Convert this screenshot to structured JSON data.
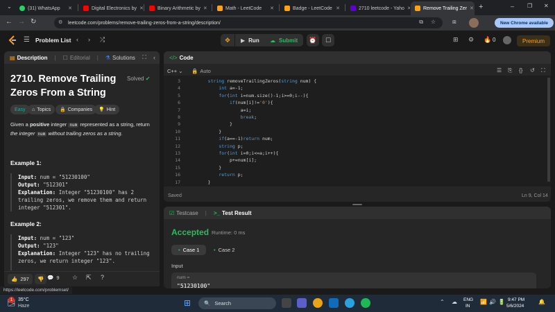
{
  "browser": {
    "tabs": [
      {
        "label": "(31) WhatsApp",
        "color": "#25d366"
      },
      {
        "label": "Digital Electronics by",
        "color": "#ff0000"
      },
      {
        "label": "Binary Arithmetic by",
        "color": "#ff0000"
      },
      {
        "label": "Math - LeetCode",
        "color": "#ffa116"
      },
      {
        "label": "Badge - LeetCode",
        "color": "#ffa116"
      },
      {
        "label": "2710 leetcode - Yaho",
        "color": "#6001d2"
      },
      {
        "label": "Remove Trailing Zer",
        "color": "#ffa116"
      }
    ],
    "url": "leetcode.com/problems/remove-trailing-zeros-from-a-string/description/",
    "new_chrome_label": "New Chrome available",
    "status_url": "https://leetcode.com/problemset/"
  },
  "nav": {
    "problem_list": "Problem List",
    "run": "Run",
    "submit": "Submit",
    "streak": "0",
    "premium": "Premium"
  },
  "left_panel": {
    "tabs": [
      "Description",
      "Editorial",
      "Solutions"
    ],
    "title": "2710. Remove Trailing Zeros From a String",
    "solved": "Solved",
    "chips": [
      "Easy",
      "Topics",
      "Companies",
      "Hint"
    ],
    "desc_parts": [
      "Given a ",
      "positive",
      " integer ",
      "num",
      " represented as a string, return ",
      "the integer ",
      "num",
      " without trailing zeros as a string",
      "."
    ],
    "examples": [
      {
        "title": "Example 1:",
        "input_label": "Input:",
        "input": "num = \"51230100\"",
        "output_label": "Output:",
        "output": "\"512301\"",
        "expl_label": "Explanation:",
        "expl": "Integer \"51230100\" has 2 trailing zeros, we remove them and return integer \"512301\"."
      },
      {
        "title": "Example 2:",
        "input_label": "Input:",
        "input": "num = \"123\"",
        "output_label": "Output:",
        "output": "\"123\"",
        "expl_label": "Explanation:",
        "expl": "Integer \"123\" has no trailing zeros, we return integer \"123\"."
      }
    ],
    "likes": "297",
    "comments": "9"
  },
  "code_panel": {
    "title": "Code",
    "language": "C++",
    "auto": "Auto",
    "lines": [
      {
        "n": "3",
        "t": "    string removeTrailingZeros(string num) {"
      },
      {
        "n": "4",
        "t": "        int a=-1;"
      },
      {
        "n": "5",
        "t": "        for(int i=num.size()-1;i>=0;i--){"
      },
      {
        "n": "6",
        "t": "            if(num[i]!='0'){"
      },
      {
        "n": "7",
        "t": "                a=i;"
      },
      {
        "n": "8",
        "t": "                break;"
      },
      {
        "n": "9",
        "t": "            }"
      },
      {
        "n": "10",
        "t": "        }"
      },
      {
        "n": "11",
        "t": "        if(a==-1)return num;"
      },
      {
        "n": "12",
        "t": "        string p;"
      },
      {
        "n": "13",
        "t": "        for(int i=0;i<=a;i++){"
      },
      {
        "n": "14",
        "t": "            p+=num[i];"
      },
      {
        "n": "15",
        "t": "        }"
      },
      {
        "n": "16",
        "t": "        return p;"
      },
      {
        "n": "17",
        "t": "    }"
      }
    ],
    "saved": "Saved",
    "cursor": "Ln 9, Col 14"
  },
  "result_panel": {
    "tab_testcase": "Testcase",
    "tab_result": "Test Result",
    "status": "Accepted",
    "runtime": "Runtime: 0 ms",
    "cases": [
      "Case 1",
      "Case 2"
    ],
    "input_label": "Input",
    "param": "num =",
    "value": "\"51230100\""
  },
  "taskbar": {
    "temp": "35°C",
    "weather": "Haze",
    "search": "Search",
    "lang1": "ENG",
    "lang2": "IN",
    "time": "9:47 PM",
    "date": "5/6/2024",
    "badge": "1"
  },
  "colors": {
    "accepted": "#2cbb5d",
    "easy": "#00b8a3",
    "leetcode_orange": "#ffa116",
    "keyword": "#569cd6",
    "string": "#ce9178"
  }
}
